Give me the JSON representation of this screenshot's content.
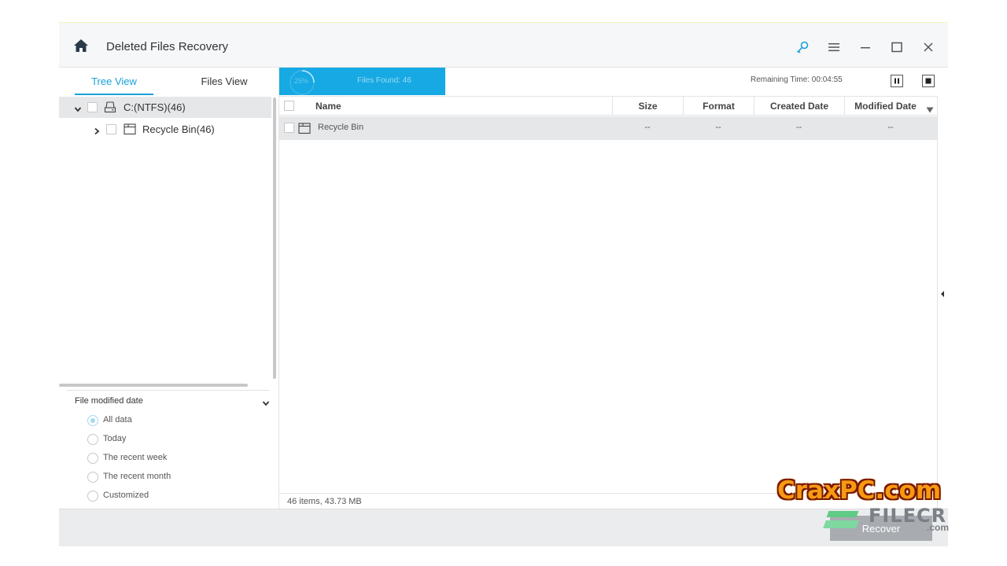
{
  "window": {
    "title": "Deleted Files Recovery"
  },
  "left_panel": {
    "tabs": [
      {
        "label": "Tree View",
        "active": true
      },
      {
        "label": "Files View",
        "active": false
      }
    ],
    "tree": [
      {
        "label": "C:(NTFS)(46)",
        "expanded": true
      },
      {
        "label": "Recycle Bin(46)",
        "expanded": false
      }
    ],
    "filter": {
      "title": "File modified date",
      "options": [
        "All data",
        "Today",
        "The recent week",
        "The recent month",
        "Customized"
      ],
      "selected": "All data"
    }
  },
  "scan": {
    "percent": "25%",
    "progress_fraction": 0.25,
    "files_found": "Files Found:  46",
    "remaining": "Remaining Time: 00:04:55"
  },
  "table": {
    "columns": [
      "Name",
      "Size",
      "Format",
      "Created Date",
      "Modified Date"
    ],
    "rows": [
      {
        "name": "Recycle Bin",
        "size": "--",
        "format": "--",
        "created": "--",
        "modified": "--"
      }
    ]
  },
  "status": {
    "text": "46 items, 43.73 MB"
  },
  "footer": {
    "recover_label": "Recover"
  },
  "watermark": {
    "crax": "CraxPC.com",
    "filecr": "FILECR",
    "com": ".com"
  },
  "colors": {
    "accent": "#16a9e3",
    "tree_active": "#1aa0d8",
    "selected_row": "#e6e7e9"
  }
}
